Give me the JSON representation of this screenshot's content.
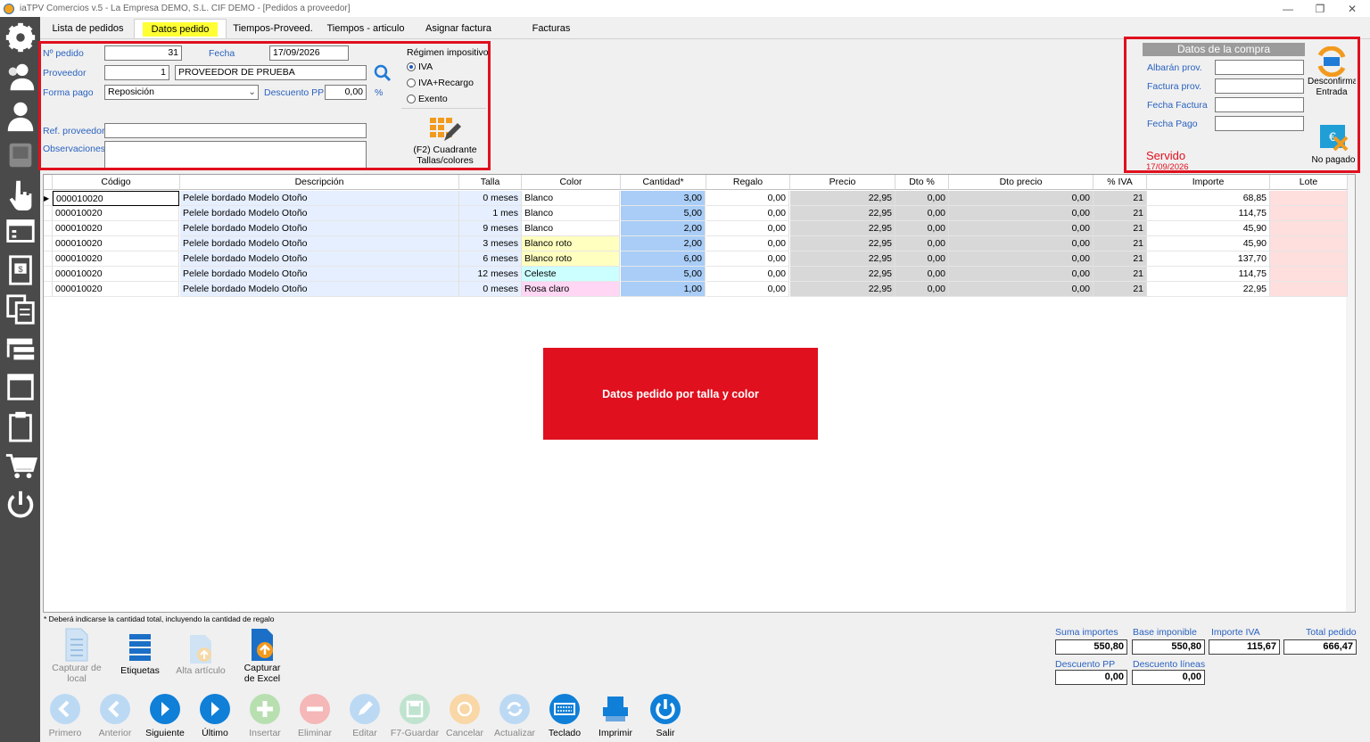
{
  "window": {
    "title": "iaTPV Comercios v.5 - La Empresa DEMO, S.L. CIF DEMO - [Pedidos a proveedor]",
    "minimize": "—",
    "maximize": "❐",
    "close": "✕"
  },
  "sidebar": [
    "gear-icon",
    "users-group-icon",
    "user-icon",
    "terminal-icon",
    "hand-pointer-icon",
    "window-list-icon",
    "invoice-icon",
    "copy-documents-icon",
    "tree-icon",
    "panel-icon",
    "clipboard-icon",
    "cart-icon",
    "power-icon"
  ],
  "tabs": [
    "Lista de pedidos",
    "Datos pedido",
    "Tiempos-Proveed.",
    "Tiempos - articulo",
    "Asignar factura",
    "Facturas"
  ],
  "form": {
    "pedido_label": "Nº pedido",
    "pedido_value": "31",
    "fecha_label": "Fecha",
    "fecha_value": "17/09/2026",
    "proveedor_label": "Proveedor",
    "proveedor_code": "1",
    "proveedor_name": "PROVEEDOR DE PRUEBA",
    "forma_pago_label": "Forma pago",
    "forma_pago_value": "Reposición",
    "descuento_label": "Descuento PP",
    "descuento_value": "0,00",
    "percent": "%",
    "ref_label": "Ref. proveedor",
    "ref_value": "",
    "obs_label": "Observaciones",
    "obs_value": "",
    "regimen_label": "Régimen impositivo",
    "regimen_options": [
      "IVA",
      "IVA+Recargo",
      "Exento"
    ],
    "regimen_selected": "IVA",
    "cuadrante_label": "(F2) Cuadrante Tallas/colores"
  },
  "compra": {
    "title": "Datos de la compra",
    "albaran_label": "Albarán prov.",
    "albaran_value": "",
    "factura_label": "Factura prov.",
    "factura_value": "",
    "fecha_factura_label": "Fecha Factura",
    "fecha_factura_value": "",
    "fecha_pago_label": "Fecha Pago",
    "fecha_pago_value": "",
    "desconfirmar_label": "Desconfirmar Entrada",
    "no_pagado_label": "No pagado",
    "servido_label": "Servido",
    "servido_date": "17/09/2026"
  },
  "grid": {
    "columns": [
      "Código",
      "Descripción",
      "Talla",
      "Color",
      "Cantidad*",
      "Regalo",
      "Precio",
      "Dto %",
      "Dto precio",
      "% IVA",
      "Importe",
      "Lote"
    ],
    "rows": [
      {
        "codigo": "000010020",
        "descripcion": "Pelele bordado Modelo Otoño",
        "talla": "0 meses",
        "color": "Blanco",
        "color_bg": "#ffffff",
        "cantidad": "3,00",
        "regalo": "0,00",
        "precio": "22,95",
        "dto": "0,00",
        "dto_precio": "0,00",
        "iva": "21",
        "importe": "68,85",
        "lote": ""
      },
      {
        "codigo": "000010020",
        "descripcion": "Pelele bordado Modelo Otoño",
        "talla": "1 mes",
        "color": "Blanco",
        "color_bg": "#ffffff",
        "cantidad": "5,00",
        "regalo": "0,00",
        "precio": "22,95",
        "dto": "0,00",
        "dto_precio": "0,00",
        "iva": "21",
        "importe": "114,75",
        "lote": ""
      },
      {
        "codigo": "000010020",
        "descripcion": "Pelele bordado Modelo Otoño",
        "talla": "9 meses",
        "color": "Blanco",
        "color_bg": "#ffffff",
        "cantidad": "2,00",
        "regalo": "0,00",
        "precio": "22,95",
        "dto": "0,00",
        "dto_precio": "0,00",
        "iva": "21",
        "importe": "45,90",
        "lote": ""
      },
      {
        "codigo": "000010020",
        "descripcion": "Pelele bordado Modelo Otoño",
        "talla": "3 meses",
        "color": "Blanco roto",
        "color_bg": "#ffffc0",
        "cantidad": "2,00",
        "regalo": "0,00",
        "precio": "22,95",
        "dto": "0,00",
        "dto_precio": "0,00",
        "iva": "21",
        "importe": "45,90",
        "lote": ""
      },
      {
        "codigo": "000010020",
        "descripcion": "Pelele bordado Modelo Otoño",
        "talla": "6 meses",
        "color": "Blanco roto",
        "color_bg": "#ffffc0",
        "cantidad": "6,00",
        "regalo": "0,00",
        "precio": "22,95",
        "dto": "0,00",
        "dto_precio": "0,00",
        "iva": "21",
        "importe": "137,70",
        "lote": ""
      },
      {
        "codigo": "000010020",
        "descripcion": "Pelele bordado Modelo Otoño",
        "talla": "12 meses",
        "color": "Celeste",
        "color_bg": "#ccffff",
        "cantidad": "5,00",
        "regalo": "0,00",
        "precio": "22,95",
        "dto": "0,00",
        "dto_precio": "0,00",
        "iva": "21",
        "importe": "114,75",
        "lote": ""
      },
      {
        "codigo": "000010020",
        "descripcion": "Pelele bordado Modelo Otoño",
        "talla": "0 meses",
        "color": "Rosa claro",
        "color_bg": "#ffd6f4",
        "cantidad": "1,00",
        "regalo": "0,00",
        "precio": "22,95",
        "dto": "0,00",
        "dto_precio": "0,00",
        "iva": "21",
        "importe": "22,95",
        "lote": ""
      }
    ]
  },
  "banner": "Datos pedido por talla y color",
  "note": "* Deberá indicarse la cantidad total, incluyendo la cantidad  de regalo",
  "tools": [
    {
      "label": "Capturar de local",
      "enabled": false,
      "icon": "document-icon"
    },
    {
      "label": "Etiquetas",
      "enabled": true,
      "icon": "labels-icon"
    },
    {
      "label": "Alta artículo",
      "enabled": false,
      "icon": "new-item-icon"
    },
    {
      "label": "Capturar de Excel",
      "enabled": true,
      "icon": "excel-import-icon"
    }
  ],
  "totals": {
    "suma_label": "Suma importes",
    "suma": "550,80",
    "base_label": "Base imponible",
    "base": "550,80",
    "iva_label": "Importe IVA",
    "iva": "115,67",
    "total_label": "Total pedido",
    "total": "666,47",
    "desc_pp_label": "Descuento PP",
    "desc_pp": "0,00",
    "desc_lineas_label": "Descuento líneas",
    "desc_lineas": "0,00"
  },
  "nav": [
    {
      "label": "Primero",
      "enabled": false,
      "icon": "first-icon"
    },
    {
      "label": "Anterior",
      "enabled": false,
      "icon": "previous-icon"
    },
    {
      "label": "Siguiente",
      "enabled": true,
      "icon": "next-icon"
    },
    {
      "label": "Último",
      "enabled": true,
      "icon": "last-icon"
    },
    {
      "label": "Insertar",
      "enabled": false,
      "icon": "insert-icon"
    },
    {
      "label": "Eliminar",
      "enabled": false,
      "icon": "delete-icon"
    },
    {
      "label": "Editar",
      "enabled": false,
      "icon": "edit-icon"
    },
    {
      "label": "F7-Guardar",
      "enabled": false,
      "icon": "save-icon"
    },
    {
      "label": "Cancelar",
      "enabled": false,
      "icon": "cancel-icon"
    },
    {
      "label": "Actualizar",
      "enabled": false,
      "icon": "refresh-icon"
    },
    {
      "label": "Teclado",
      "enabled": true,
      "icon": "keyboard-icon"
    },
    {
      "label": "Imprimir",
      "enabled": true,
      "icon": "printer-icon"
    },
    {
      "label": "Salir",
      "enabled": true,
      "icon": "exit-icon"
    }
  ],
  "colors": {
    "frame": "#e0101e",
    "label_blue": "#2a62c0",
    "active_tab": "#ffff33",
    "cantidad_bg": "#a9cdf7",
    "gray_col": "#d8d8d8",
    "lote_bg": "#ffdede",
    "desc_bg": "#e6efff"
  }
}
